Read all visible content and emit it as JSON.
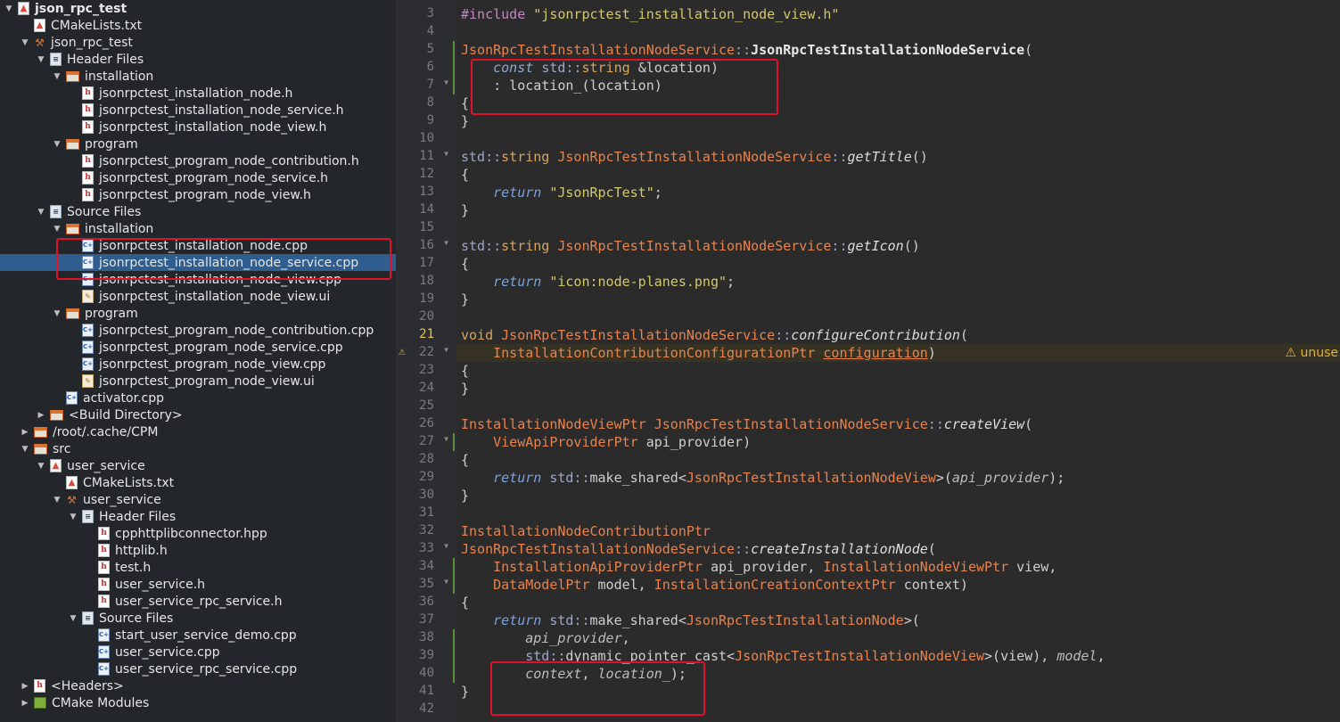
{
  "tree": {
    "rows": [
      {
        "label": "json_rpc_test",
        "icon": "cmake-project-icon",
        "arrow": "down",
        "bold": true
      },
      {
        "label": "CMakeLists.txt",
        "icon": "cmake-file-icon",
        "arrow": "none"
      },
      {
        "label": "json_rpc_test",
        "icon": "hammer-icon",
        "arrow": "down"
      },
      {
        "label": "Header Files",
        "icon": "header-files-icon",
        "arrow": "down"
      },
      {
        "label": "installation",
        "icon": "folder-icon",
        "arrow": "down"
      },
      {
        "label": "jsonrpctest_installation_node.h",
        "icon": "header-file-icon",
        "arrow": "none"
      },
      {
        "label": "jsonrpctest_installation_node_service.h",
        "icon": "header-file-icon",
        "arrow": "none"
      },
      {
        "label": "jsonrpctest_installation_node_view.h",
        "icon": "header-file-icon",
        "arrow": "none"
      },
      {
        "label": "program",
        "icon": "folder-icon",
        "arrow": "down"
      },
      {
        "label": "jsonrpctest_program_node_contribution.h",
        "icon": "header-file-icon",
        "arrow": "none"
      },
      {
        "label": "jsonrpctest_program_node_service.h",
        "icon": "header-file-icon",
        "arrow": "none"
      },
      {
        "label": "jsonrpctest_program_node_view.h",
        "icon": "header-file-icon",
        "arrow": "none"
      },
      {
        "label": "Source Files",
        "icon": "source-files-icon",
        "arrow": "down"
      },
      {
        "label": "installation",
        "icon": "folder-icon",
        "arrow": "down"
      },
      {
        "label": "jsonrpctest_installation_node.cpp",
        "icon": "cpp-file-icon",
        "arrow": "none"
      },
      {
        "label": "jsonrpctest_installation_node_service.cpp",
        "icon": "cpp-file-icon",
        "arrow": "none",
        "selected": true
      },
      {
        "label": "jsonrpctest_installation_node_view.cpp",
        "icon": "cpp-file-icon",
        "arrow": "none"
      },
      {
        "label": "jsonrpctest_installation_node_view.ui",
        "icon": "ui-file-icon",
        "arrow": "none"
      },
      {
        "label": "program",
        "icon": "folder-icon",
        "arrow": "down"
      },
      {
        "label": "jsonrpctest_program_node_contribution.cpp",
        "icon": "cpp-file-icon",
        "arrow": "none"
      },
      {
        "label": "jsonrpctest_program_node_service.cpp",
        "icon": "cpp-file-icon",
        "arrow": "none"
      },
      {
        "label": "jsonrpctest_program_node_view.cpp",
        "icon": "cpp-file-icon",
        "arrow": "none"
      },
      {
        "label": "jsonrpctest_program_node_view.ui",
        "icon": "ui-file-icon",
        "arrow": "none"
      },
      {
        "label": "activator.cpp",
        "icon": "cpp-file-icon",
        "arrow": "none"
      },
      {
        "label": "<Build Directory>",
        "icon": "folder-icon",
        "arrow": "right"
      },
      {
        "label": "/root/.cache/CPM",
        "icon": "folder-icon",
        "arrow": "right"
      },
      {
        "label": "src",
        "icon": "folder-icon",
        "arrow": "down"
      },
      {
        "label": "user_service",
        "icon": "cmake-project-icon",
        "arrow": "down"
      },
      {
        "label": "CMakeLists.txt",
        "icon": "cmake-file-icon",
        "arrow": "none"
      },
      {
        "label": "user_service",
        "icon": "hammer-icon",
        "arrow": "down"
      },
      {
        "label": "Header Files",
        "icon": "header-files-icon",
        "arrow": "down"
      },
      {
        "label": "cpphttplibconnector.hpp",
        "icon": "header-file-icon",
        "arrow": "none"
      },
      {
        "label": "httplib.h",
        "icon": "header-file-icon",
        "arrow": "none"
      },
      {
        "label": "test.h",
        "icon": "header-file-icon",
        "arrow": "none"
      },
      {
        "label": "user_service.h",
        "icon": "header-file-icon",
        "arrow": "none"
      },
      {
        "label": "user_service_rpc_service.h",
        "icon": "header-file-icon",
        "arrow": "none"
      },
      {
        "label": "Source Files",
        "icon": "source-files-icon",
        "arrow": "down"
      },
      {
        "label": "start_user_service_demo.cpp",
        "icon": "cpp-file-icon",
        "arrow": "none"
      },
      {
        "label": "user_service.cpp",
        "icon": "cpp-file-icon",
        "arrow": "none"
      },
      {
        "label": "user_service_rpc_service.cpp",
        "icon": "cpp-file-icon",
        "arrow": "none"
      },
      {
        "label": "<Headers>",
        "icon": "headers-icon",
        "arrow": "right"
      },
      {
        "label": "CMake Modules",
        "icon": "cmake-modules-icon",
        "arrow": "right"
      }
    ]
  },
  "editor": {
    "current_line": "21",
    "warning": {
      "line": "22",
      "message": "unuse"
    },
    "lines": [
      {
        "n": "3",
        "fold": false,
        "changed": false,
        "code": [
          [
            "macro",
            "#include "
          ],
          [
            "str",
            "\"jsonrpctest_installation_node_view.h\""
          ]
        ]
      },
      {
        "n": "4",
        "fold": false,
        "changed": false,
        "code": []
      },
      {
        "n": "5",
        "fold": false,
        "changed": true,
        "code": [
          [
            "type",
            "JsonRpcTestInstallationNodeService"
          ],
          [
            "ns",
            "::"
          ],
          [
            "fn",
            "JsonRpcTestInstallationNodeService"
          ],
          [
            "op",
            "("
          ]
        ]
      },
      {
        "n": "6",
        "fold": false,
        "changed": true,
        "code": [
          [
            "op",
            "    "
          ],
          [
            "kwi",
            "const "
          ],
          [
            "ns",
            "std::"
          ],
          [
            "kw",
            "string "
          ],
          [
            "op",
            "&location)"
          ]
        ]
      },
      {
        "n": "7",
        "fold": true,
        "changed": true,
        "code": [
          [
            "op",
            "    : location_(location)"
          ]
        ]
      },
      {
        "n": "8",
        "fold": false,
        "changed": false,
        "code": [
          [
            "op",
            "{"
          ]
        ]
      },
      {
        "n": "9",
        "fold": false,
        "changed": false,
        "code": [
          [
            "op",
            "}"
          ]
        ]
      },
      {
        "n": "10",
        "fold": false,
        "changed": false,
        "code": []
      },
      {
        "n": "11",
        "fold": true,
        "changed": false,
        "code": [
          [
            "ns",
            "std::"
          ],
          [
            "kw",
            "string "
          ],
          [
            "type",
            "JsonRpcTestInstallationNodeService"
          ],
          [
            "ns",
            "::"
          ],
          [
            "fni",
            "getTitle"
          ],
          [
            "op",
            "()"
          ]
        ]
      },
      {
        "n": "12",
        "fold": false,
        "changed": false,
        "code": [
          [
            "op",
            "{"
          ]
        ]
      },
      {
        "n": "13",
        "fold": false,
        "changed": false,
        "code": [
          [
            "op",
            "    "
          ],
          [
            "ret",
            "return "
          ],
          [
            "str",
            "\"JsonRpcTest\""
          ],
          [
            "op",
            ";"
          ]
        ]
      },
      {
        "n": "14",
        "fold": false,
        "changed": false,
        "code": [
          [
            "op",
            "}"
          ]
        ]
      },
      {
        "n": "15",
        "fold": false,
        "changed": false,
        "code": []
      },
      {
        "n": "16",
        "fold": true,
        "changed": false,
        "code": [
          [
            "ns",
            "std::"
          ],
          [
            "kw",
            "string "
          ],
          [
            "type",
            "JsonRpcTestInstallationNodeService"
          ],
          [
            "ns",
            "::"
          ],
          [
            "fni",
            "getIcon"
          ],
          [
            "op",
            "()"
          ]
        ]
      },
      {
        "n": "17",
        "fold": false,
        "changed": false,
        "code": [
          [
            "op",
            "{"
          ]
        ]
      },
      {
        "n": "18",
        "fold": false,
        "changed": false,
        "code": [
          [
            "op",
            "    "
          ],
          [
            "ret",
            "return "
          ],
          [
            "str",
            "\"icon:node-planes.png\""
          ],
          [
            "op",
            ";"
          ]
        ]
      },
      {
        "n": "19",
        "fold": false,
        "changed": false,
        "code": [
          [
            "op",
            "}"
          ]
        ]
      },
      {
        "n": "20",
        "fold": false,
        "changed": false,
        "code": []
      },
      {
        "n": "21",
        "fold": false,
        "changed": false,
        "code": [
          [
            "kw",
            "void "
          ],
          [
            "type",
            "JsonRpcTestInstallationNodeService"
          ],
          [
            "ns",
            "::"
          ],
          [
            "fni",
            "configureContribution"
          ],
          [
            "op",
            "("
          ]
        ]
      },
      {
        "n": "22",
        "fold": true,
        "changed": false,
        "code": [
          [
            "op",
            "    "
          ],
          [
            "type",
            "InstallationContributionConfigurationPtr "
          ],
          [
            "u",
            "configuration"
          ],
          [
            "op",
            ")"
          ]
        ]
      },
      {
        "n": "23",
        "fold": false,
        "changed": false,
        "code": [
          [
            "op",
            "{"
          ]
        ]
      },
      {
        "n": "24",
        "fold": false,
        "changed": false,
        "code": [
          [
            "op",
            "}"
          ]
        ]
      },
      {
        "n": "25",
        "fold": false,
        "changed": false,
        "code": []
      },
      {
        "n": "26",
        "fold": false,
        "changed": false,
        "code": [
          [
            "type",
            "InstallationNodeViewPtr "
          ],
          [
            "type",
            "JsonRpcTestInstallationNodeService"
          ],
          [
            "ns",
            "::"
          ],
          [
            "fni",
            "createView"
          ],
          [
            "op",
            "("
          ]
        ]
      },
      {
        "n": "27",
        "fold": true,
        "changed": true,
        "code": [
          [
            "op",
            "    "
          ],
          [
            "type",
            "ViewApiProviderPtr "
          ],
          [
            "op",
            "api_provider)"
          ]
        ]
      },
      {
        "n": "28",
        "fold": false,
        "changed": false,
        "code": [
          [
            "op",
            "{"
          ]
        ]
      },
      {
        "n": "29",
        "fold": false,
        "changed": false,
        "code": [
          [
            "op",
            "    "
          ],
          [
            "ret",
            "return "
          ],
          [
            "ns",
            "std::"
          ],
          [
            "op",
            "make_shared<"
          ],
          [
            "type",
            "JsonRpcTestInstallationNodeView"
          ],
          [
            "op",
            ">("
          ],
          [
            "par",
            "api_provider"
          ],
          [
            "op",
            ");"
          ]
        ]
      },
      {
        "n": "30",
        "fold": false,
        "changed": false,
        "code": [
          [
            "op",
            "}"
          ]
        ]
      },
      {
        "n": "31",
        "fold": false,
        "changed": false,
        "code": []
      },
      {
        "n": "32",
        "fold": false,
        "changed": false,
        "code": [
          [
            "type",
            "InstallationNodeContributionPtr"
          ]
        ]
      },
      {
        "n": "33",
        "fold": true,
        "changed": false,
        "code": [
          [
            "type",
            "JsonRpcTestInstallationNodeService"
          ],
          [
            "ns",
            "::"
          ],
          [
            "fni",
            "createInstallationNode"
          ],
          [
            "op",
            "("
          ]
        ]
      },
      {
        "n": "34",
        "fold": false,
        "changed": true,
        "code": [
          [
            "op",
            "    "
          ],
          [
            "type",
            "InstallationApiProviderPtr "
          ],
          [
            "op",
            "api_provider, "
          ],
          [
            "type",
            "InstallationNodeViewPtr "
          ],
          [
            "op",
            "view,"
          ]
        ]
      },
      {
        "n": "35",
        "fold": true,
        "changed": true,
        "code": [
          [
            "op",
            "    "
          ],
          [
            "type",
            "DataModelPtr "
          ],
          [
            "op",
            "model, "
          ],
          [
            "type",
            "InstallationCreationContextPtr "
          ],
          [
            "op",
            "context)"
          ]
        ]
      },
      {
        "n": "36",
        "fold": false,
        "changed": false,
        "code": [
          [
            "op",
            "{"
          ]
        ]
      },
      {
        "n": "37",
        "fold": false,
        "changed": false,
        "code": [
          [
            "op",
            "    "
          ],
          [
            "ret",
            "return "
          ],
          [
            "ns",
            "std::"
          ],
          [
            "op",
            "make_shared<"
          ],
          [
            "type",
            "JsonRpcTestInstallationNode"
          ],
          [
            "op",
            ">("
          ]
        ]
      },
      {
        "n": "38",
        "fold": false,
        "changed": true,
        "code": [
          [
            "op",
            "        "
          ],
          [
            "par",
            "api_provider"
          ],
          [
            "op",
            ","
          ]
        ]
      },
      {
        "n": "39",
        "fold": false,
        "changed": true,
        "code": [
          [
            "op",
            "        "
          ],
          [
            "ns",
            "std::"
          ],
          [
            "op",
            "dynamic_pointer_cast<"
          ],
          [
            "type",
            "JsonRpcTestInstallationNodeView"
          ],
          [
            "op",
            ">(view), "
          ],
          [
            "par",
            "model"
          ],
          [
            "op",
            ","
          ]
        ]
      },
      {
        "n": "40",
        "fold": false,
        "changed": true,
        "code": [
          [
            "op",
            "        "
          ],
          [
            "par",
            "context"
          ],
          [
            "op",
            ", "
          ],
          [
            "par",
            "location_"
          ],
          [
            "op",
            ");"
          ]
        ]
      },
      {
        "n": "41",
        "fold": false,
        "changed": false,
        "code": [
          [
            "op",
            "}"
          ]
        ]
      },
      {
        "n": "42",
        "fold": false,
        "changed": false,
        "code": []
      }
    ]
  }
}
